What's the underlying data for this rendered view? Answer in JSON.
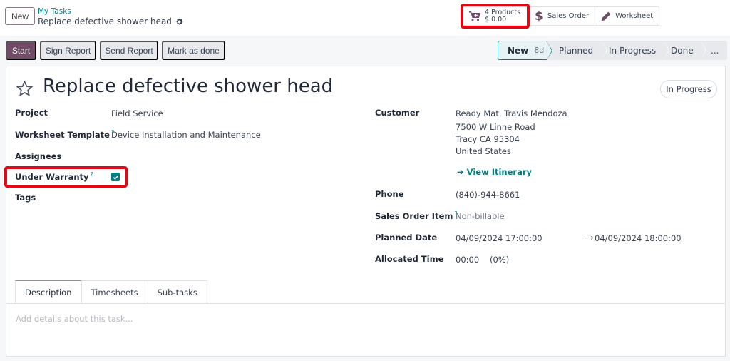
{
  "control_panel": {
    "new_button": "New",
    "breadcrumb": {
      "parent": "My Tasks",
      "current": "Replace defective shower head"
    },
    "smart_buttons": [
      {
        "icon": "cart-plus-icon",
        "line1": "4 Products",
        "line2": "$ 0.00",
        "highlighted": true
      },
      {
        "icon": "dollar-icon",
        "label": "Sales Order"
      },
      {
        "icon": "pencil-icon",
        "label": "Worksheet"
      }
    ]
  },
  "actions": {
    "start": "Start",
    "sign_report": "Sign Report",
    "send_report": "Send Report",
    "mark_done": "Mark as done"
  },
  "statusbar": {
    "stages": [
      {
        "label": "New",
        "duration": "8d",
        "active": true
      },
      {
        "label": "Planned"
      },
      {
        "label": "In Progress"
      },
      {
        "label": "Done"
      },
      {
        "label": "..."
      }
    ]
  },
  "task": {
    "title": "Replace defective shower head",
    "state": "In Progress",
    "left_fields": {
      "project": {
        "label": "Project",
        "value": "Field Service"
      },
      "worksheet_template": {
        "label": "Worksheet Template",
        "help": "?",
        "value": "Device Installation and Maintenance"
      },
      "assignees": {
        "label": "Assignees",
        "value": ""
      },
      "under_warranty": {
        "label": "Under Warranty",
        "help": "?",
        "checked": true
      },
      "tags": {
        "label": "Tags",
        "value": ""
      }
    },
    "right_fields": {
      "customer": {
        "label": "Customer",
        "name": "Ready Mat, Travis Mendoza",
        "street": "7500 W Linne Road",
        "city": "Tracy CA 95304",
        "country": "United States",
        "itinerary_link": "View Itinerary"
      },
      "phone": {
        "label": "Phone",
        "value": "(840)-944-8661"
      },
      "sales_order_item": {
        "label": "Sales Order Item",
        "help": "?",
        "value": "Non-billable"
      },
      "planned_date": {
        "label": "Planned Date",
        "start": "04/09/2024 17:00:00",
        "end": "04/09/2024 18:00:00"
      },
      "allocated_time": {
        "label": "Allocated Time",
        "value": "00:00",
        "percent": "(0%)"
      }
    }
  },
  "notebook": {
    "tabs": [
      "Description",
      "Timesheets",
      "Sub-tasks"
    ],
    "active_tab": "Description",
    "description_placeholder": "Add details about this task..."
  },
  "colors": {
    "brand": "#714b67",
    "accent": "#017e84",
    "highlight": "#e30613"
  }
}
